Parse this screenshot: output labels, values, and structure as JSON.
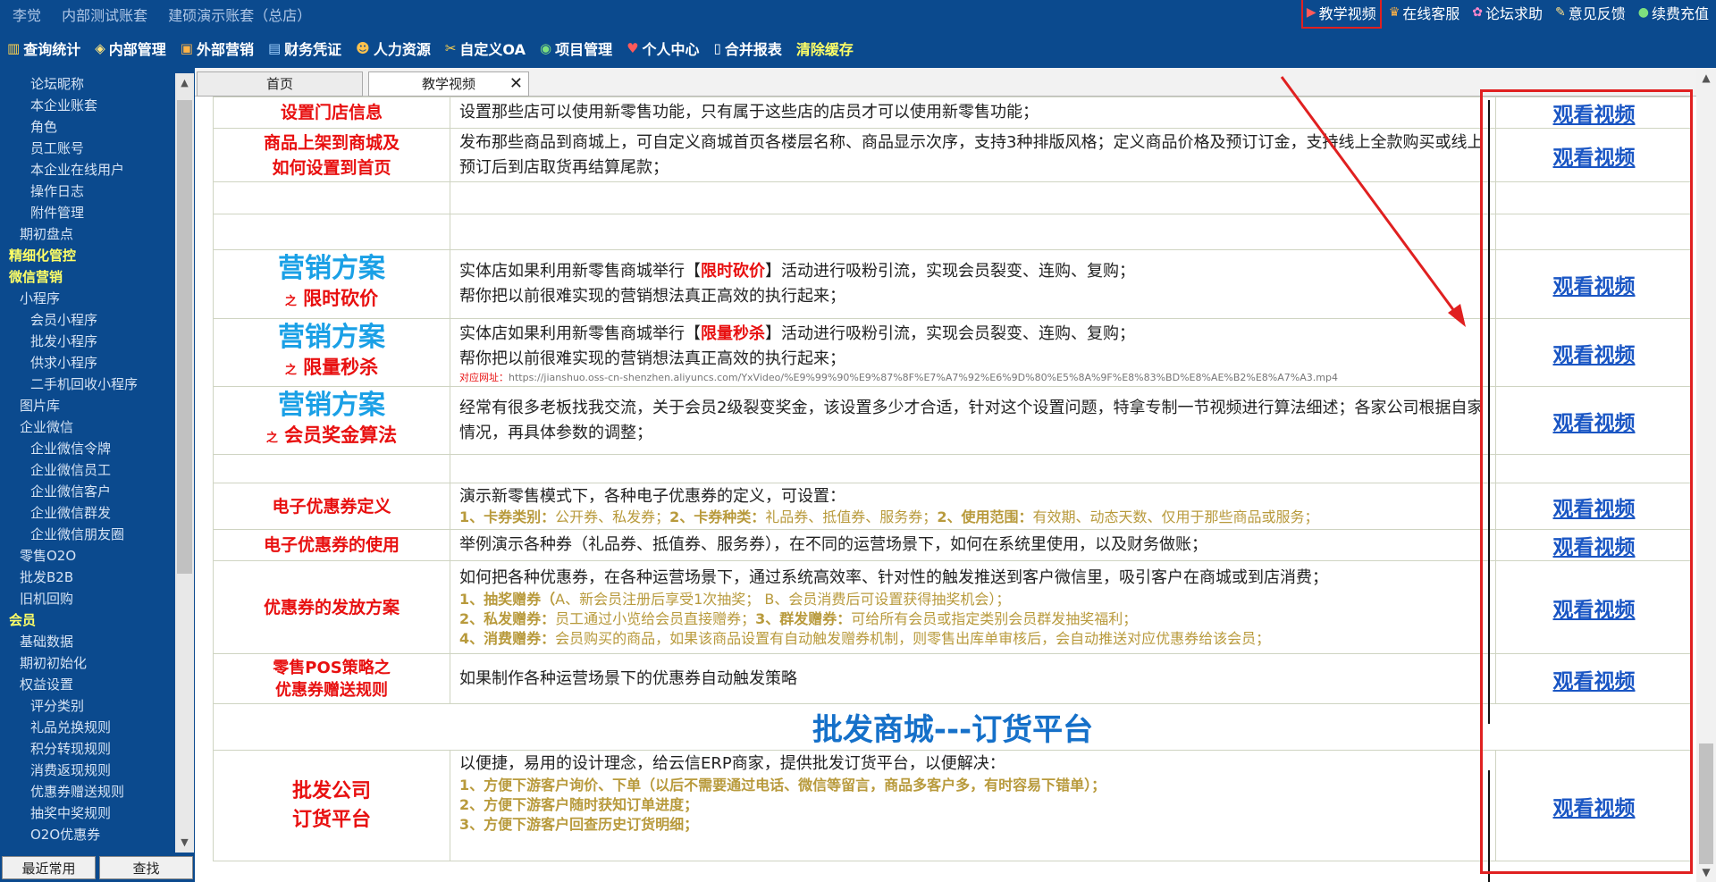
{
  "header": {
    "user_name": "李觉",
    "account_1": "内部测试账套",
    "account_2": "建硕演示账套（总店）",
    "top_links": [
      {
        "label": "教学视频",
        "icon": "play-icon"
      },
      {
        "label": "在线客服",
        "icon": "service-icon"
      },
      {
        "label": "论坛求助",
        "icon": "forum-icon"
      },
      {
        "label": "意见反馈",
        "icon": "feedback-icon"
      },
      {
        "label": "续费充值",
        "icon": "wechat-icon"
      }
    ],
    "main_menu": [
      {
        "label": "查询统计",
        "icon": "chart-icon"
      },
      {
        "label": "内部管理",
        "icon": "internal-icon"
      },
      {
        "label": "外部营销",
        "icon": "marketing-icon"
      },
      {
        "label": "财务凭证",
        "icon": "voucher-icon"
      },
      {
        "label": "人力资源",
        "icon": "hr-icon"
      },
      {
        "label": "自定义OA",
        "icon": "tools-icon"
      },
      {
        "label": "项目管理",
        "icon": "project-icon"
      },
      {
        "label": "个人中心",
        "icon": "heart-icon"
      },
      {
        "label": "合并报表",
        "icon": "report-icon"
      },
      {
        "label": "清除缓存",
        "icon": ""
      }
    ]
  },
  "sidebar": {
    "items": [
      {
        "label": "论坛昵称",
        "level": 3
      },
      {
        "label": "本企业账套",
        "level": 3
      },
      {
        "label": "角色",
        "level": 3
      },
      {
        "label": "员工账号",
        "level": 3
      },
      {
        "label": "本企业在线用户",
        "level": 3
      },
      {
        "label": "操作日志",
        "level": 3
      },
      {
        "label": "附件管理",
        "level": 3
      },
      {
        "label": "期初盘点",
        "level": 2
      },
      {
        "label": "精细化管控",
        "level": 1
      },
      {
        "label": "微信营销",
        "level": 1
      },
      {
        "label": "小程序",
        "level": 2
      },
      {
        "label": "会员小程序",
        "level": 3
      },
      {
        "label": "批发小程序",
        "level": 3
      },
      {
        "label": "供求小程序",
        "level": 3
      },
      {
        "label": "二手机回收小程序",
        "level": 3
      },
      {
        "label": "图片库",
        "level": 2
      },
      {
        "label": "企业微信",
        "level": 2
      },
      {
        "label": "企业微信令牌",
        "level": 3
      },
      {
        "label": "企业微信员工",
        "level": 3
      },
      {
        "label": "企业微信客户",
        "level": 3
      },
      {
        "label": "企业微信群发",
        "level": 3
      },
      {
        "label": "企业微信朋友圈",
        "level": 3
      },
      {
        "label": "零售O2O",
        "level": 2
      },
      {
        "label": "批发B2B",
        "level": 2
      },
      {
        "label": "旧机回购",
        "level": 2
      },
      {
        "label": "会员",
        "level": 1
      },
      {
        "label": "基础数据",
        "level": 2
      },
      {
        "label": "期初初始化",
        "level": 2
      },
      {
        "label": "权益设置",
        "level": 2
      },
      {
        "label": "评分类别",
        "level": 3
      },
      {
        "label": "礼品兑换规则",
        "level": 3
      },
      {
        "label": "积分转现规则",
        "level": 3
      },
      {
        "label": "消费返现规则",
        "level": 3
      },
      {
        "label": "优惠券赠送规则",
        "level": 3
      },
      {
        "label": "抽奖中奖规则",
        "level": 3
      },
      {
        "label": "O2O优惠券",
        "level": 3
      }
    ],
    "btn_recent": "最近常用",
    "btn_find": "查找"
  },
  "tabs": {
    "home": "首页",
    "video": "教学视频",
    "close": "✕"
  },
  "content": {
    "watch_label": "观看视频",
    "rows": {
      "store_info": {
        "name": "设置门店信息",
        "desc": "设置那些店可以使用新零售功能，只有属于这些店的店员才可以使用新零售功能；"
      },
      "shelf": {
        "name1": "商品上架到商城及",
        "name2": "如何设置到首页",
        "desc": "发布那些商品到商城上，可自定义商城首页各楼层名称、商品显示次序，支持3种排版风格；定义商品价格及预订订金，支持线上全款购买或线上预订后到店取货再结算尾款；"
      },
      "bargain": {
        "title": "营销方案",
        "zhi": "之",
        "sub": "限时砍价",
        "d1a": "实体店如果利用新零售商城举行【",
        "kw": "限时砍价",
        "d1b": "】活动进行吸粉引流，实现会员裂变、连购、复购；",
        "d2": "帮你把以前很难实现的营销想法真正高效的执行起来；"
      },
      "flash": {
        "title": "营销方案",
        "zhi": "之",
        "sub": "限量秒杀",
        "d1a": "实体店如果利用新零售商城举行【",
        "kw": "限量秒杀",
        "d1b": "】活动进行吸粉引流，实现会员裂变、连购、复购；",
        "d2": "帮你把以前很难实现的营销想法真正高效的执行起来；",
        "url_label": "对应网址：",
        "url": "https://jianshuo.oss-cn-shenzhen.aliyuncs.com/YxVideo/%E9%99%90%E9%87%8F%E7%A7%92%E6%9D%80%E5%8A%9F%E8%83%BD%E8%AE%B2%E8%A7%A3.mp4"
      },
      "bonus": {
        "title": "营销方案",
        "zhi": "之",
        "sub": "会员奖金算法",
        "desc": "经常有很多老板找我交流，关于会员2级裂变奖金，该设置多少才合适，针对这个设置问题，特拿专制一节视频进行算法细述；各家公司根据自家情况，再具体参数的调整；"
      },
      "coupon_def": {
        "name": "电子优惠券定义",
        "desc": "演示新零售模式下，各种电子优惠券的定义，可设置：",
        "s1k": "1、卡券类别：",
        "s1v": "公开券、私发券；",
        "s2k": "2、卡券种类：",
        "s2v": "礼品券、抵值券、服务券；",
        "s3k": "2、使用范围：",
        "s3v": "有效期、动态天数、仅用于那些商品或服务；"
      },
      "coupon_use": {
        "name": "电子优惠券的使用",
        "desc": "举例演示各种券（礼品券、抵值券、服务券），在不同的运营场景下，如何在系统里使用，以及财务做账；"
      },
      "coupon_issue": {
        "name": "优惠券的发放方案",
        "desc": "如何把各种优惠券，在各种运营场景下，通过系统高效率、针对性的触发推送到客户微信里，吸引客户在商城或到店消费；",
        "l1k": "1、抽奖赠券（",
        "l1v": "A、新会员注册后享受1次抽奖；   B、会员消费后可设置获得抽奖机会）；",
        "l2k": "2、私发赠券：",
        "l2v": "员工通过小览给会员直接赠券；",
        "l3k": "3、群发赠券：",
        "l3v": "可给所有会员或指定类别会员群发抽奖福利；",
        "l4k": "4、消费赠券：",
        "l4v": "会员购买的商品，如果该商品设置有自动触发赠券机制，则零售出库单审核后，会自动推送对应优惠券给该会员；"
      },
      "pos": {
        "name1": "零售POS策略之",
        "name2": "优惠券赠送规则",
        "desc": "如果制作各种运营场景下的优惠券自动触发策略"
      },
      "banner": "批发商城---订货平台",
      "wholesale": {
        "name1": "批发公司",
        "name2": "订货平台",
        "desc": "以便捷，易用的设计理念，给云信ERP商家，提供批发订货平台，以便解决：",
        "p1": "1、方便下游客户询价、下单（以后不需要通过电话、微信等留言，商品多客户多，有时容易下错单）；",
        "p2": "2、方便下游客户随时获知订单进度；",
        "p3": "3、方便下游客户回查历史订货明细；"
      }
    }
  },
  "colors": {
    "header_bg": "#0b4a8e",
    "menu_yellow": "#ffff66",
    "name_red": "#e81010",
    "link_blue": "#1a56c4",
    "annotation_red": "#e02020"
  }
}
